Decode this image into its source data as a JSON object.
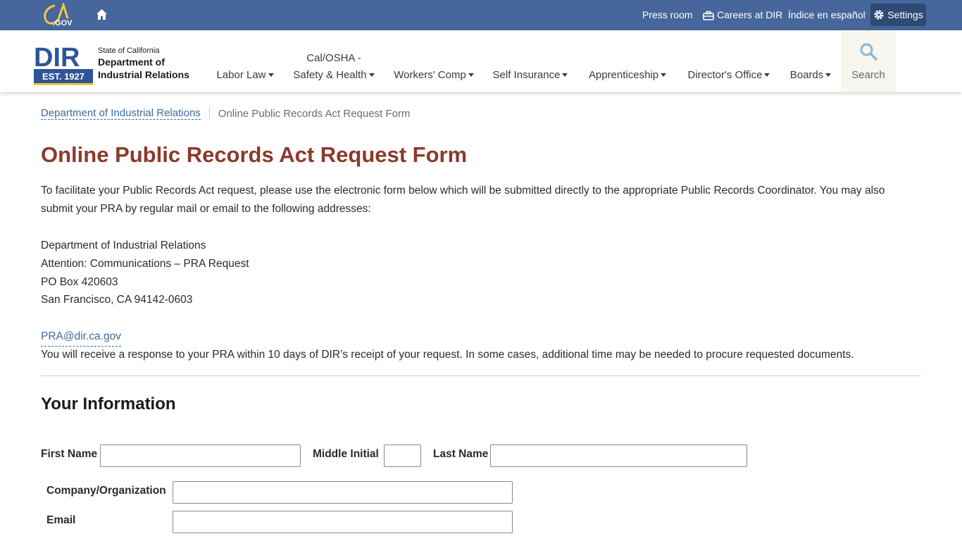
{
  "utility": {
    "ca_logo_text": "CA.GOV",
    "press_room": "Press room",
    "careers": "Careers at DIR",
    "espanol": "Índice en español",
    "settings": "Settings"
  },
  "header": {
    "logo_letters": "DIR",
    "logo_est": "EST. 1927",
    "state": "State of California",
    "dept_line1": "Department of",
    "dept_line2": "Industrial Relations",
    "nav": [
      {
        "label": "Labor Law"
      },
      {
        "label_top": "Cal/OSHA -",
        "label": "Safety & Health"
      },
      {
        "label": "Workers' Comp"
      },
      {
        "label": "Self Insurance"
      },
      {
        "label": "Apprenticeship"
      },
      {
        "label": "Director's Office"
      },
      {
        "label": "Boards"
      }
    ],
    "search_label": "Search"
  },
  "breadcrumb": {
    "home": "Department of Industrial Relations",
    "current": "Online Public Records Act Request Form"
  },
  "content": {
    "title": "Online Public Records Act Request Form",
    "intro": "To facilitate your Public Records Act request, please use the electronic form below which will be submitted directly to the appropriate Public Records Coordinator. You may also submit your PRA by regular mail or email to the following addresses:",
    "address": [
      "Department of Industrial Relations",
      "Attention: Communications – PRA Request",
      "PO Box 420603",
      "San Francisco, CA 94142-0603"
    ],
    "email": "PRA@dir.ca.gov",
    "response": "You will receive a response to your PRA within 10 days of DIR’s receipt of your request. In some cases, additional time may be needed to procure requested documents.",
    "section_title": "Your Information"
  },
  "form": {
    "first_name_label": "First Name",
    "first_name_value": "",
    "middle_initial_label": "Middle Initial",
    "middle_initial_value": "",
    "last_name_label": "Last Name",
    "last_name_value": "",
    "company_label": "Company/Organization",
    "company_value": "",
    "email_label": "Email",
    "email_value": ""
  },
  "colors": {
    "utility_bar": "#46669c",
    "title": "#8b3a2a",
    "link": "#3e6a9a"
  }
}
